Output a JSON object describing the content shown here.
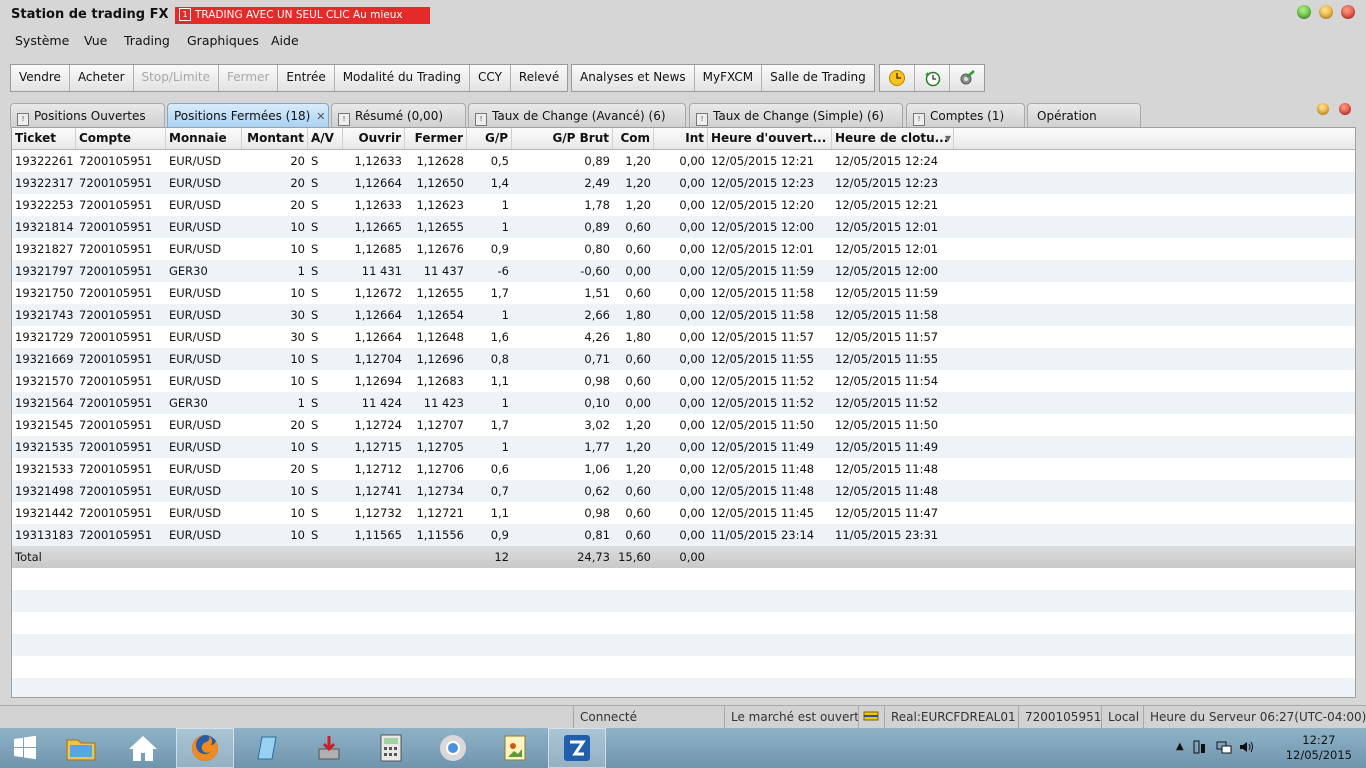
{
  "window": {
    "title": "Station de trading FX",
    "alert": {
      "number": "1",
      "text": "TRADING AVEC UN SEUL CLIC Au mieux",
      "color": "#e52a2a"
    }
  },
  "menu": [
    "Système",
    "Vue",
    "Trading",
    "Graphiques",
    "Aide"
  ],
  "toolbar": {
    "group1": [
      {
        "label": "Vendre",
        "enabled": true
      },
      {
        "label": "Acheter",
        "enabled": true
      },
      {
        "label": "Stop/Limite",
        "enabled": false
      },
      {
        "label": "Fermer",
        "enabled": false
      },
      {
        "label": "Entrée",
        "enabled": true
      },
      {
        "label": "Modalité du Trading",
        "enabled": true
      },
      {
        "label": "CCY",
        "enabled": true
      },
      {
        "label": "Relevé",
        "enabled": true
      }
    ],
    "group2": [
      "Analyses et News",
      "MyFXCM",
      "Salle de Trading"
    ],
    "icons": [
      "clock-icon",
      "refresh-clock-icon",
      "settings-gear-icon"
    ]
  },
  "tabs": [
    {
      "label": "Positions Ouvertes",
      "active": false
    },
    {
      "label": "Positions Fermées (18)",
      "active": true
    },
    {
      "label": "Résumé (0,00)",
      "active": false
    },
    {
      "label": "Taux de Change (Avancé) (6)",
      "active": false
    },
    {
      "label": "Taux de Change (Simple) (6)",
      "active": false
    },
    {
      "label": "Comptes (1)",
      "active": false
    },
    {
      "label": "Opération",
      "active": false
    }
  ],
  "table": {
    "columns": [
      "Ticket",
      "Compte",
      "Monnaie",
      "Montant",
      "A/V",
      "Ouvrir",
      "Fermer",
      "G/P",
      "G/P Brut",
      "Com",
      "Int",
      "Heure d'ouvert...",
      "Heure de clotu..."
    ],
    "rows": [
      [
        "19322261",
        "7200105951",
        "EUR/USD",
        "20",
        "S",
        "1,12633",
        "1,12628",
        "0,5",
        "0,89",
        "1,20",
        "0,00",
        "12/05/2015 12:21",
        "12/05/2015 12:24"
      ],
      [
        "19322317",
        "7200105951",
        "EUR/USD",
        "20",
        "S",
        "1,12664",
        "1,12650",
        "1,4",
        "2,49",
        "1,20",
        "0,00",
        "12/05/2015 12:23",
        "12/05/2015 12:23"
      ],
      [
        "19322253",
        "7200105951",
        "EUR/USD",
        "20",
        "S",
        "1,12633",
        "1,12623",
        "1",
        "1,78",
        "1,20",
        "0,00",
        "12/05/2015 12:20",
        "12/05/2015 12:21"
      ],
      [
        "19321814",
        "7200105951",
        "EUR/USD",
        "10",
        "S",
        "1,12665",
        "1,12655",
        "1",
        "0,89",
        "0,60",
        "0,00",
        "12/05/2015 12:00",
        "12/05/2015 12:01"
      ],
      [
        "19321827",
        "7200105951",
        "EUR/USD",
        "10",
        "S",
        "1,12685",
        "1,12676",
        "0,9",
        "0,80",
        "0,60",
        "0,00",
        "12/05/2015 12:01",
        "12/05/2015 12:01"
      ],
      [
        "19321797",
        "7200105951",
        "GER30",
        "1",
        "S",
        "11 431",
        "11 437",
        "-6",
        "-0,60",
        "0,00",
        "0,00",
        "12/05/2015 11:59",
        "12/05/2015 12:00"
      ],
      [
        "19321750",
        "7200105951",
        "EUR/USD",
        "10",
        "S",
        "1,12672",
        "1,12655",
        "1,7",
        "1,51",
        "0,60",
        "0,00",
        "12/05/2015 11:58",
        "12/05/2015 11:59"
      ],
      [
        "19321743",
        "7200105951",
        "EUR/USD",
        "30",
        "S",
        "1,12664",
        "1,12654",
        "1",
        "2,66",
        "1,80",
        "0,00",
        "12/05/2015 11:58",
        "12/05/2015 11:58"
      ],
      [
        "19321729",
        "7200105951",
        "EUR/USD",
        "30",
        "S",
        "1,12664",
        "1,12648",
        "1,6",
        "4,26",
        "1,80",
        "0,00",
        "12/05/2015 11:57",
        "12/05/2015 11:57"
      ],
      [
        "19321669",
        "7200105951",
        "EUR/USD",
        "10",
        "S",
        "1,12704",
        "1,12696",
        "0,8",
        "0,71",
        "0,60",
        "0,00",
        "12/05/2015 11:55",
        "12/05/2015 11:55"
      ],
      [
        "19321570",
        "7200105951",
        "EUR/USD",
        "10",
        "S",
        "1,12694",
        "1,12683",
        "1,1",
        "0,98",
        "0,60",
        "0,00",
        "12/05/2015 11:52",
        "12/05/2015 11:54"
      ],
      [
        "19321564",
        "7200105951",
        "GER30",
        "1",
        "S",
        "11 424",
        "11 423",
        "1",
        "0,10",
        "0,00",
        "0,00",
        "12/05/2015 11:52",
        "12/05/2015 11:52"
      ],
      [
        "19321545",
        "7200105951",
        "EUR/USD",
        "20",
        "S",
        "1,12724",
        "1,12707",
        "1,7",
        "3,02",
        "1,20",
        "0,00",
        "12/05/2015 11:50",
        "12/05/2015 11:50"
      ],
      [
        "19321535",
        "7200105951",
        "EUR/USD",
        "10",
        "S",
        "1,12715",
        "1,12705",
        "1",
        "1,77",
        "1,20",
        "0,00",
        "12/05/2015 11:49",
        "12/05/2015 11:49"
      ],
      [
        "19321533",
        "7200105951",
        "EUR/USD",
        "20",
        "S",
        "1,12712",
        "1,12706",
        "0,6",
        "1,06",
        "1,20",
        "0,00",
        "12/05/2015 11:48",
        "12/05/2015 11:48"
      ],
      [
        "19321498",
        "7200105951",
        "EUR/USD",
        "10",
        "S",
        "1,12741",
        "1,12734",
        "0,7",
        "0,62",
        "0,60",
        "0,00",
        "12/05/2015 11:48",
        "12/05/2015 11:48"
      ],
      [
        "19321442",
        "7200105951",
        "EUR/USD",
        "10",
        "S",
        "1,12732",
        "1,12721",
        "1,1",
        "0,98",
        "0,60",
        "0,00",
        "12/05/2015 11:45",
        "12/05/2015 11:47"
      ],
      [
        "19313183",
        "7200105951",
        "EUR/USD",
        "10",
        "S",
        "1,11565",
        "1,11556",
        "0,9",
        "0,81",
        "0,60",
        "0,00",
        "11/05/2015 23:14",
        "11/05/2015 23:31"
      ]
    ],
    "total": {
      "label": "Total",
      "gp": "12",
      "gp_brut": "24,73",
      "com": "15,60",
      "int": "0,00"
    }
  },
  "statusbar": [
    "Connecté",
    "Le marché est ouvert",
    "Real:EURCFDREAL01",
    "7200105951",
    "Local",
    "Heure du Serveur 06:27(UTC-04:00)"
  ],
  "taskbar": {
    "apps": [
      "windows-start-icon",
      "file-explorer-icon",
      "home-icon",
      "firefox-icon",
      "notepad-icon",
      "installer-icon",
      "calculator-icon",
      "chrome-icon",
      "image-viewer-icon",
      "fxcm-trading-station-icon"
    ],
    "clock_time": "12:27",
    "clock_date": "12/05/2015"
  }
}
